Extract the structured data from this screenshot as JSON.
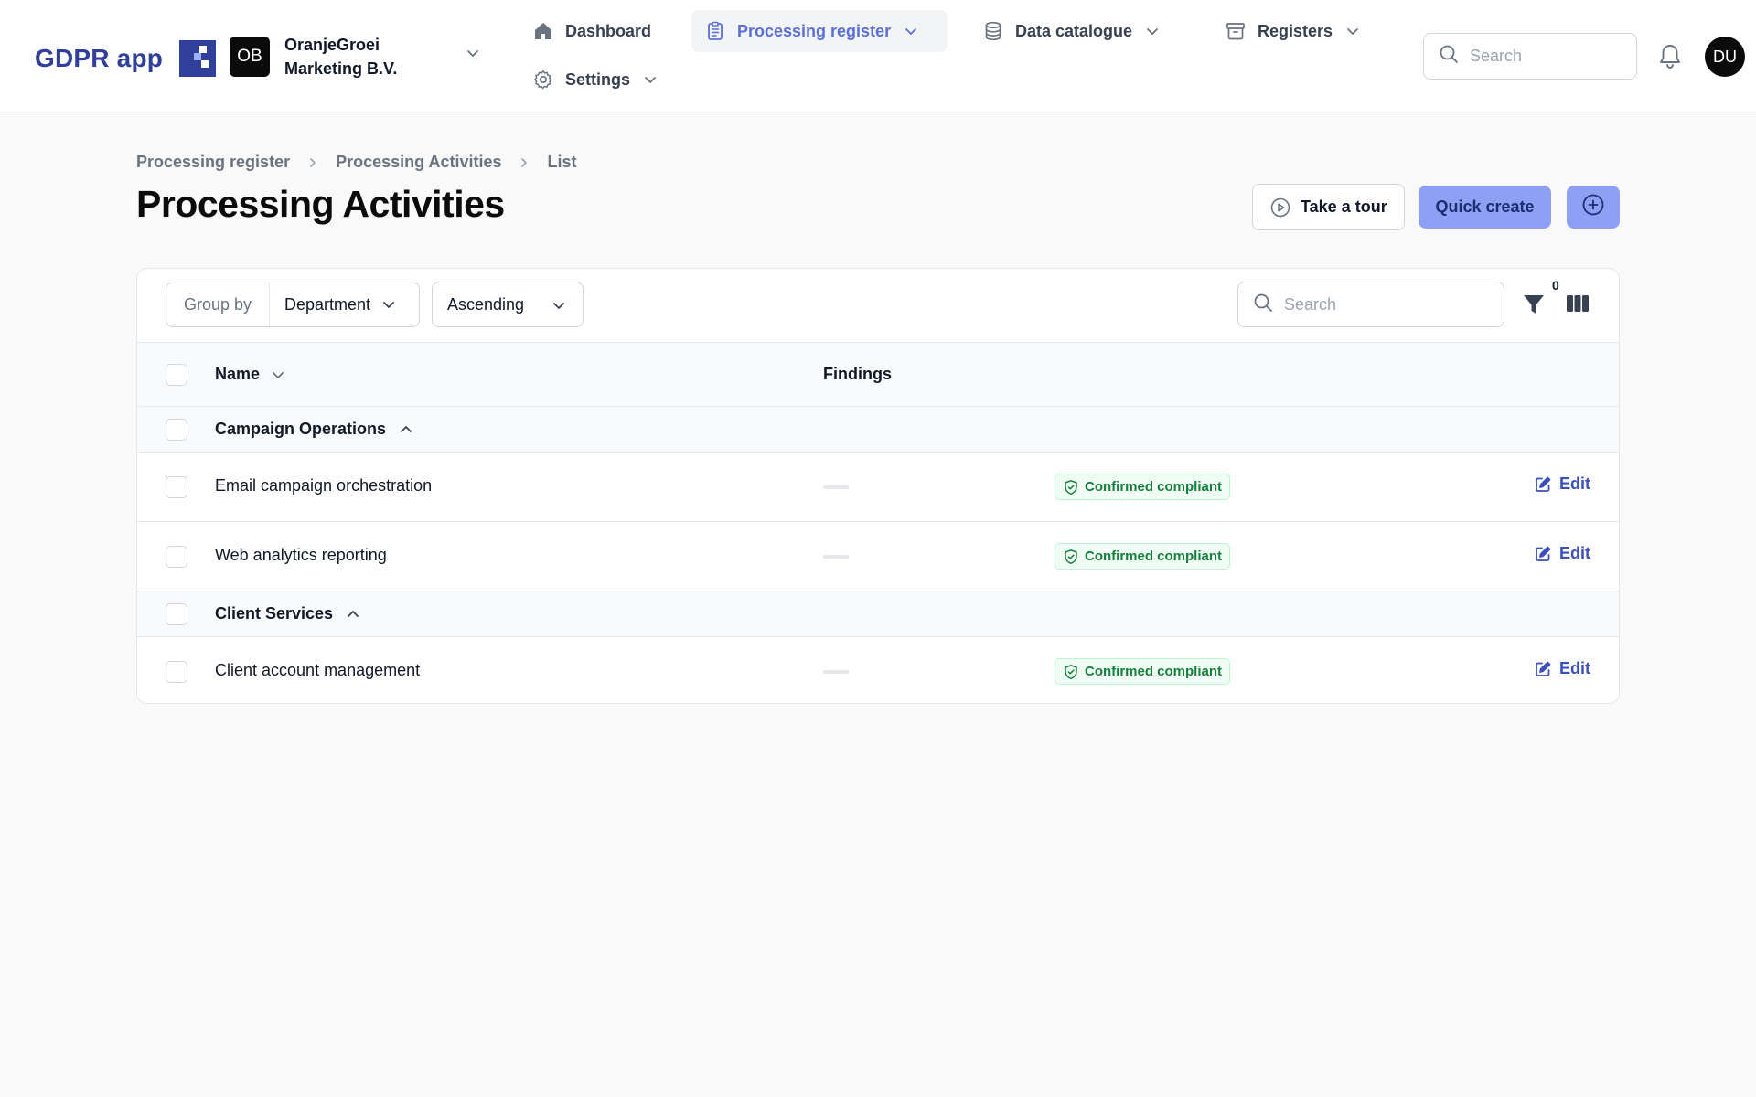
{
  "header": {
    "brand": "GDPR app",
    "org": {
      "initials": "OB",
      "name_line1": "OranjeGroei",
      "name_line2": "Marketing B.V."
    },
    "nav": {
      "dashboard": "Dashboard",
      "processing_register": "Processing register",
      "data_catalogue": "Data catalogue",
      "registers": "Registers",
      "settings": "Settings"
    },
    "search_placeholder": "Search",
    "user_initials": "DU"
  },
  "breadcrumb": [
    "Processing register",
    "Processing Activities",
    "List"
  ],
  "page": {
    "title": "Processing Activities",
    "take_tour": "Take a tour",
    "quick_create": "Quick create"
  },
  "toolbar": {
    "group_by_label": "Group by",
    "group_by_value": "Department",
    "sort_value": "Ascending",
    "search_placeholder": "Search",
    "filter_count": "0"
  },
  "table": {
    "columns": {
      "name": "Name",
      "findings": "Findings"
    },
    "groups": [
      {
        "label": "Campaign Operations",
        "rows": [
          {
            "name": "Email campaign orchestration",
            "status": "Confirmed compliant",
            "action": "Edit"
          },
          {
            "name": "Web analytics reporting",
            "status": "Confirmed compliant",
            "action": "Edit"
          }
        ]
      },
      {
        "label": "Client Services",
        "rows": [
          {
            "name": "Client account management",
            "status": "Confirmed compliant",
            "action": "Edit"
          }
        ]
      }
    ]
  },
  "colors": {
    "brand": "#2f3f9a",
    "accent_nav": "#5b6fd6",
    "primary_button": "#8da0f4",
    "status_green": "#15803d",
    "edit_link": "#3b4fbf"
  }
}
